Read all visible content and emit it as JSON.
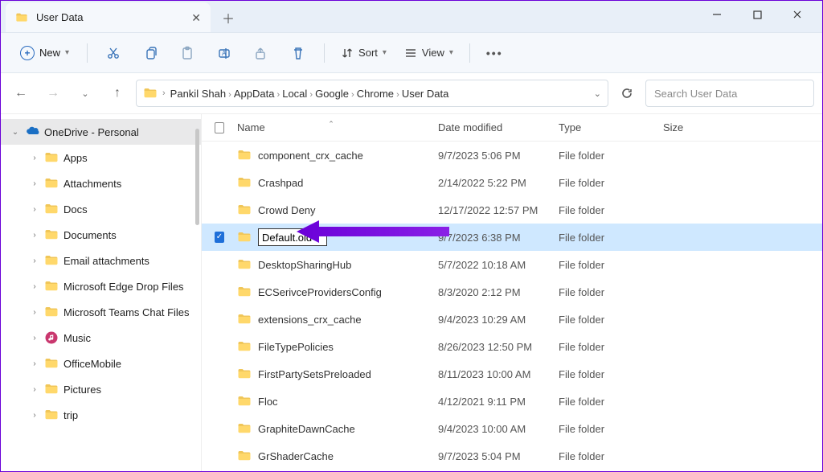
{
  "tab": {
    "title": "User Data"
  },
  "toolbar": {
    "new_label": "New",
    "sort_label": "Sort",
    "view_label": "View"
  },
  "breadcrumb": {
    "items": [
      "Pankil Shah",
      "AppData",
      "Local",
      "Google",
      "Chrome",
      "User Data"
    ]
  },
  "search": {
    "placeholder": "Search User Data"
  },
  "sidebar": {
    "top": {
      "label": "OneDrive - Personal"
    },
    "children": [
      {
        "label": "Apps"
      },
      {
        "label": "Attachments"
      },
      {
        "label": "Docs"
      },
      {
        "label": "Documents"
      },
      {
        "label": "Email attachments"
      },
      {
        "label": "Microsoft Edge Drop Files"
      },
      {
        "label": "Microsoft Teams Chat Files"
      },
      {
        "label": "Music",
        "icon": "music"
      },
      {
        "label": "OfficeMobile"
      },
      {
        "label": "Pictures"
      },
      {
        "label": "trip"
      }
    ]
  },
  "columns": {
    "name": "Name",
    "date": "Date modified",
    "type": "Type",
    "size": "Size"
  },
  "files": [
    {
      "name": "component_crx_cache",
      "date": "9/7/2023 5:06 PM",
      "type": "File folder"
    },
    {
      "name": "Crashpad",
      "date": "2/14/2022 5:22 PM",
      "type": "File folder"
    },
    {
      "name": "Crowd Deny",
      "date": "12/17/2022 12:57 PM",
      "type": "File folder"
    },
    {
      "name": "Default.old",
      "date": "9/7/2023 6:38 PM",
      "type": "File folder",
      "selected": true,
      "renaming": true
    },
    {
      "name": "DesktopSharingHub",
      "date": "5/7/2022 10:18 AM",
      "type": "File folder"
    },
    {
      "name": "ECSerivceProvidersConfig",
      "date": "8/3/2020 2:12 PM",
      "type": "File folder"
    },
    {
      "name": "extensions_crx_cache",
      "date": "9/4/2023 10:29 AM",
      "type": "File folder"
    },
    {
      "name": "FileTypePolicies",
      "date": "8/26/2023 12:50 PM",
      "type": "File folder"
    },
    {
      "name": "FirstPartySetsPreloaded",
      "date": "8/11/2023 10:00 AM",
      "type": "File folder"
    },
    {
      "name": "Floc",
      "date": "4/12/2021 9:11 PM",
      "type": "File folder"
    },
    {
      "name": "GraphiteDawnCache",
      "date": "9/4/2023 10:00 AM",
      "type": "File folder"
    },
    {
      "name": "GrShaderCache",
      "date": "9/7/2023 5:04 PM",
      "type": "File folder"
    }
  ]
}
